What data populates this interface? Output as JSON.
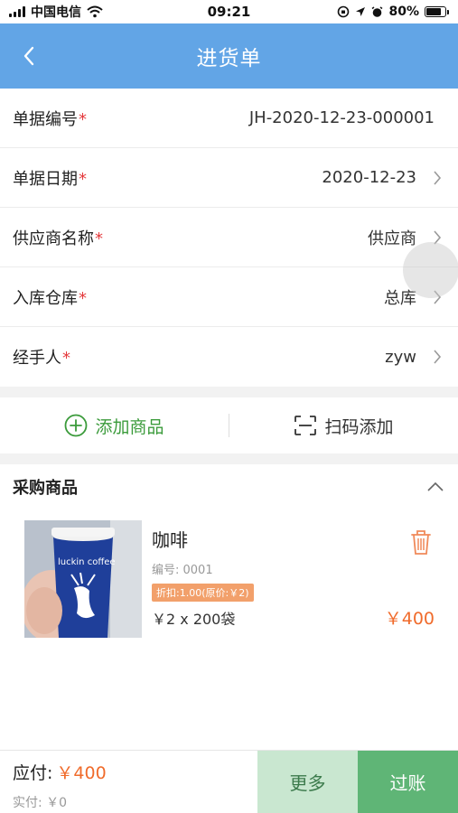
{
  "status_bar": {
    "carrier": "中国电信",
    "time": "09:21",
    "battery": "80%",
    "battery_level": 0.8
  },
  "header": {
    "title": "进货单",
    "back_icon": "chevron-left-icon"
  },
  "form": {
    "rows": [
      {
        "label": "单据编号",
        "value": "JH-2020-12-23-000001",
        "required": true,
        "has_arrow": false
      },
      {
        "label": "单据日期",
        "value": "2020-12-23",
        "required": true,
        "has_arrow": true
      },
      {
        "label": "供应商名称",
        "value": "供应商",
        "required": true,
        "has_arrow": true
      },
      {
        "label": "入库仓库",
        "value": "总库",
        "required": true,
        "has_arrow": true
      },
      {
        "label": "经手人",
        "value": "zyw",
        "required": true,
        "has_arrow": true
      }
    ],
    "required_mark": "*"
  },
  "actions": {
    "add_label": "添加商品",
    "scan_label": "扫码添加"
  },
  "purchase": {
    "title": "采购商品",
    "product": {
      "name": "咖啡",
      "code": "编号: 0001",
      "discount": "折扣:1.00(原价:￥2)",
      "qty_line": "￥2 x 200袋",
      "total": "￥400",
      "image_text": "luckin coffee"
    }
  },
  "footer": {
    "due_label": "应付:",
    "due_value": "￥400",
    "paid": "实付: ￥0",
    "more_label": "更多",
    "post_label": "过账"
  },
  "colors": {
    "header_bg": "#62a5e6",
    "accent_green": "#3b9b3b",
    "price_orange": "#f06b2b",
    "required_red": "#e4393c"
  }
}
